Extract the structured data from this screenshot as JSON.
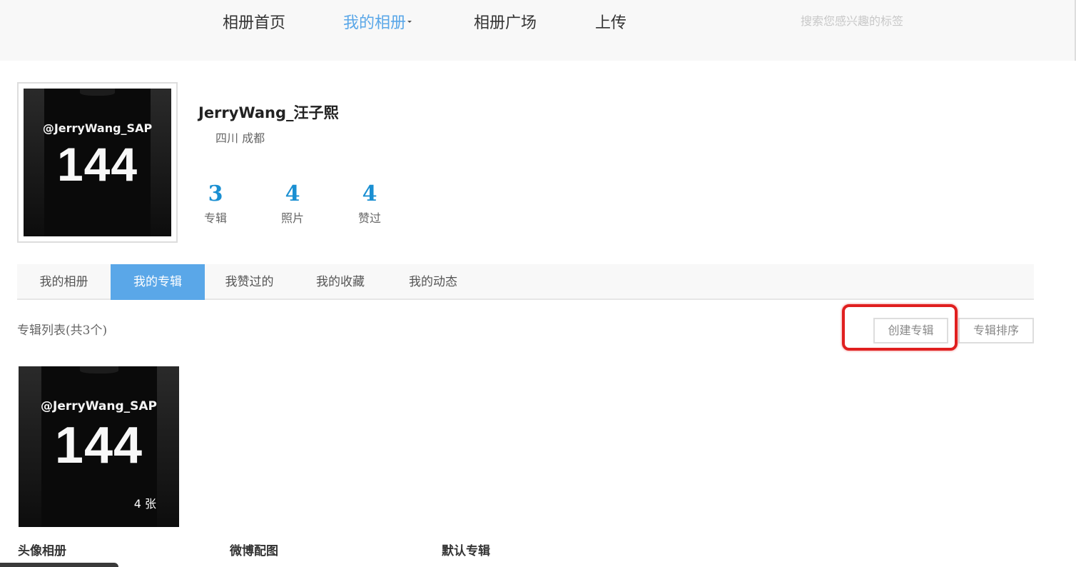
{
  "nav": {
    "items": [
      {
        "label": "相册首页"
      },
      {
        "label": "我的相册"
      },
      {
        "label": "相册广场"
      },
      {
        "label": "上传"
      }
    ],
    "search_placeholder": "搜索您感兴趣的标签",
    "active_color": "#5aa7e8"
  },
  "profile": {
    "username": "JerryWang_汪子熙",
    "location": "四川 成都",
    "avatar": {
      "handle": "@JerryWang_SAP",
      "number": "144"
    },
    "stats": [
      {
        "value": "3",
        "label": "专辑"
      },
      {
        "value": "4",
        "label": "照片"
      },
      {
        "value": "4",
        "label": "赞过"
      }
    ],
    "stat_color": "#1a8fd2"
  },
  "tabs": [
    {
      "label": "我的相册"
    },
    {
      "label": "我的专辑"
    },
    {
      "label": "我赞过的"
    },
    {
      "label": "我的收藏"
    },
    {
      "label": "我的动态"
    }
  ],
  "album_list": {
    "title": "专辑列表(共3个)",
    "create_label": "创建专辑",
    "sort_label": "专辑排序",
    "albums": [
      {
        "name": "头像相册",
        "count": "4 张",
        "cover": {
          "handle": "@JerryWang_SAP",
          "number": "144"
        }
      },
      {
        "name": "微博配图"
      },
      {
        "name": "默认专辑"
      }
    ]
  },
  "annotation_color": "#e01f1f"
}
